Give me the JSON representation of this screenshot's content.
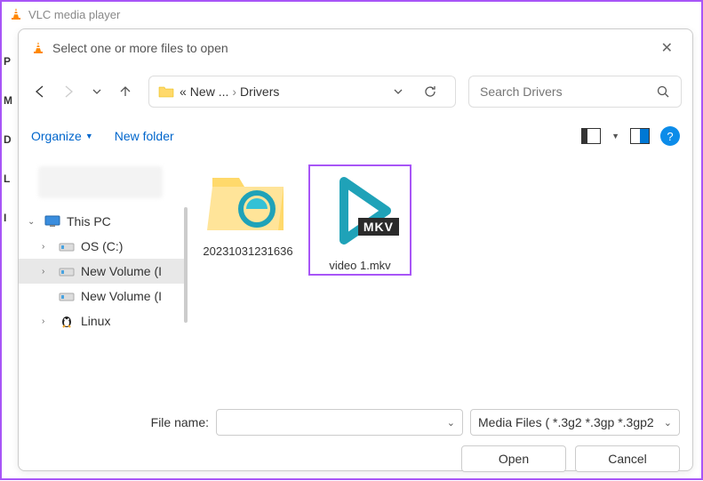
{
  "window": {
    "title": "VLC media player"
  },
  "dialog": {
    "title": "Select one or more files to open"
  },
  "path": {
    "prefix": "«",
    "seg1": "New ...",
    "seg2": "Drivers"
  },
  "search": {
    "placeholder": "Search Drivers"
  },
  "toolbar": {
    "organize": "Organize",
    "new_folder": "New folder"
  },
  "tree": {
    "this_pc": "This PC",
    "os": "OS (C:)",
    "newvol1": "New Volume (I",
    "newvol2": "New Volume (I",
    "linux": "Linux"
  },
  "files": [
    {
      "name": "20231031231636"
    },
    {
      "name": "video 1.mkv",
      "badge": "MKV"
    }
  ],
  "filename": {
    "label": "File name:"
  },
  "filetype": {
    "label": "Media Files ( *.3g2 *.3gp *.3gp2"
  },
  "buttons": {
    "open": "Open",
    "cancel": "Cancel"
  },
  "side_letters": [
    "P",
    "M",
    "D",
    "L",
    "I"
  ]
}
